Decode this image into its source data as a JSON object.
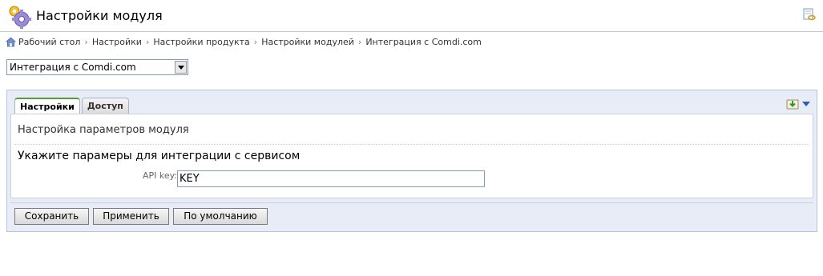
{
  "header": {
    "title": "Настройки модуля",
    "icon": "gear-icon",
    "link_icon": "link-icon"
  },
  "breadcrumb": {
    "items": [
      "Рабочий стол",
      "Настройки",
      "Настройки продукта",
      "Настройки модулей",
      "Интеграция с Comdi.com"
    ]
  },
  "module_select": {
    "selected": "Интеграция с Comdi.com"
  },
  "panel": {
    "tabs": [
      {
        "label": "Настройки",
        "active": true
      },
      {
        "label": "Доступ",
        "active": false
      }
    ],
    "section_title": "Настройка параметров модуля",
    "subtitle": "Укажите парамеры для интеграции с сервисом",
    "api_key_label": "API key:",
    "api_key_value": "KEY",
    "buttons": {
      "save": "Сохранить",
      "apply": "Применить",
      "default": "По умолчанию"
    }
  },
  "colors": {
    "active_tab_accent": "#5b9a3a",
    "panel_background": "#e7ecf6",
    "panel_border": "#b6c4dc"
  }
}
